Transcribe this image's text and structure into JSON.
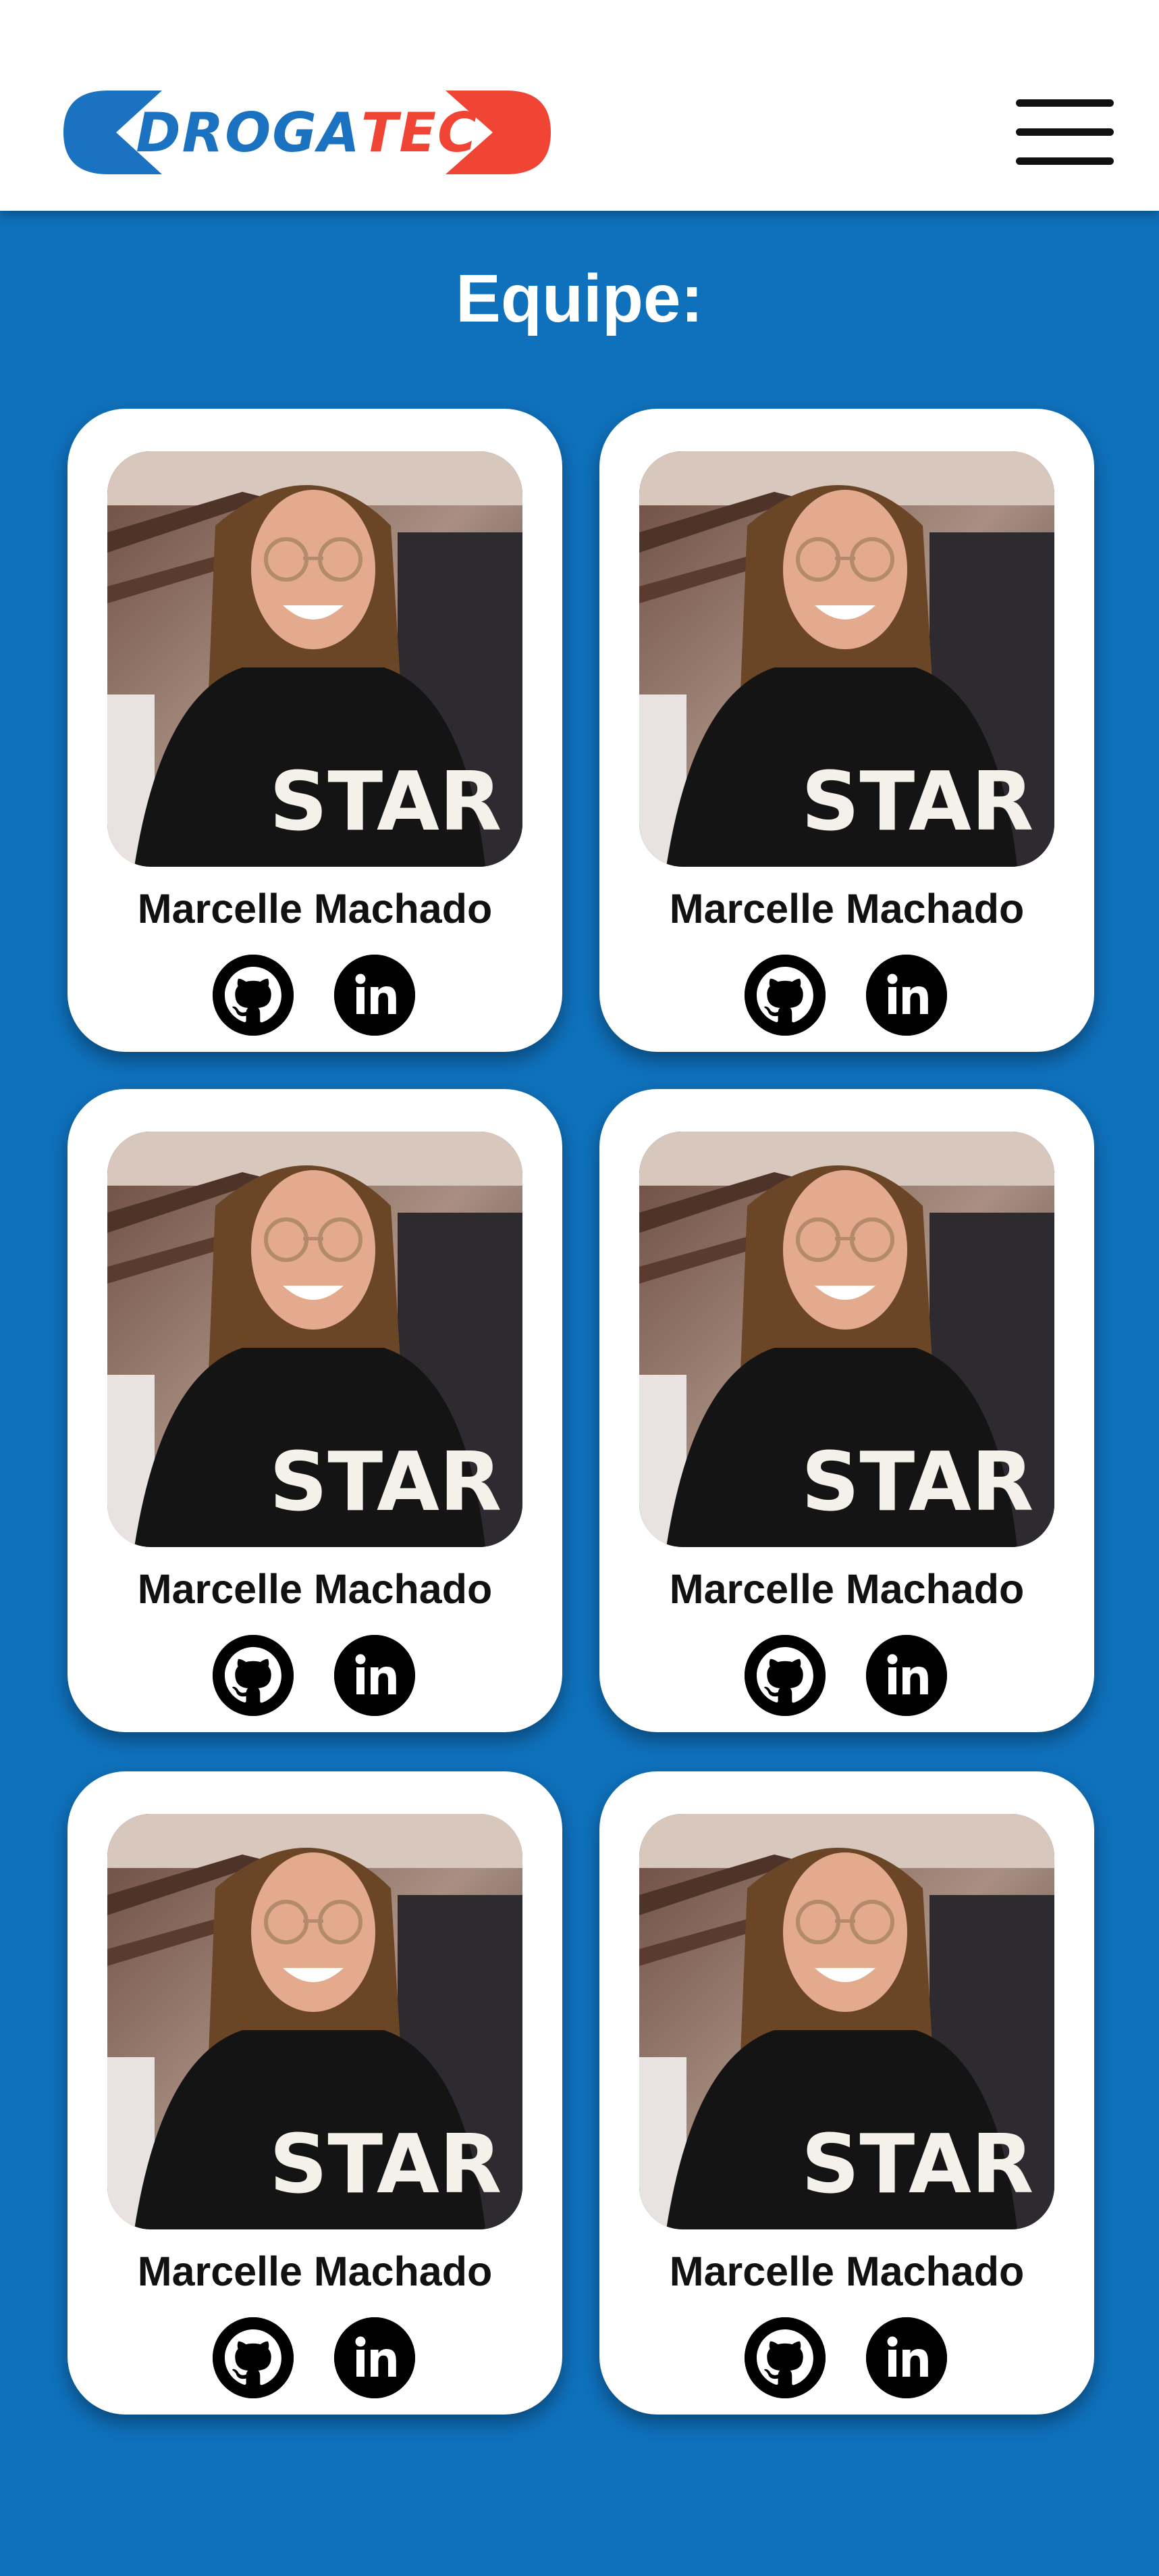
{
  "header": {
    "logo": {
      "part1": "DROGA",
      "part2": "TEC",
      "left_color": "#1a72c0",
      "right_color": "#f04535"
    },
    "menu_icon": "hamburger-menu-icon"
  },
  "page": {
    "title": "Equipe:",
    "background": "#0f70bb"
  },
  "team": [
    {
      "name": "Marcelle Machado",
      "github_icon": "github-icon",
      "linkedin_icon": "linkedin-icon"
    },
    {
      "name": "Marcelle Machado",
      "github_icon": "github-icon",
      "linkedin_icon": "linkedin-icon"
    },
    {
      "name": "Marcelle Machado",
      "github_icon": "github-icon",
      "linkedin_icon": "linkedin-icon"
    },
    {
      "name": "Marcelle Machado",
      "github_icon": "github-icon",
      "linkedin_icon": "linkedin-icon"
    },
    {
      "name": "Marcelle Machado",
      "github_icon": "github-icon",
      "linkedin_icon": "linkedin-icon"
    },
    {
      "name": "Marcelle Machado",
      "github_icon": "github-icon",
      "linkedin_icon": "linkedin-icon"
    }
  ]
}
